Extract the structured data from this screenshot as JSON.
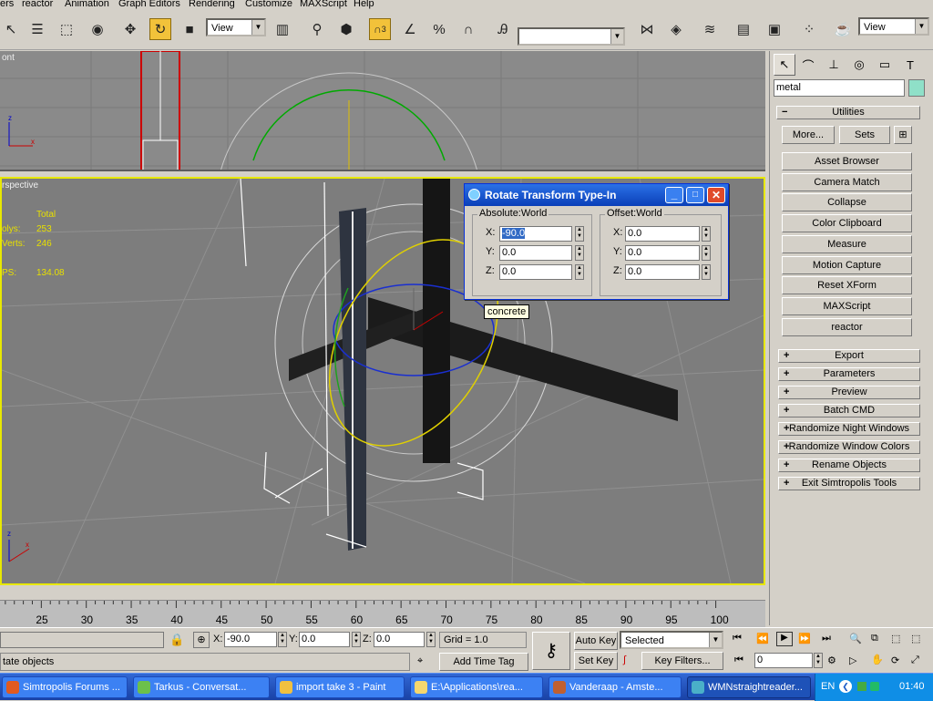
{
  "menu": [
    "ers",
    "reactor",
    "Animation",
    "Graph Editors",
    "Rendering",
    "Customize",
    "MAXScript",
    "Help"
  ],
  "toolbar": {
    "view_dropdown": "View",
    "view_dropdown_right": "View",
    "named_selection": "",
    "snap_num": "3"
  },
  "viewports": {
    "top_label": "ont",
    "persp_label": "rspective",
    "stats_header": "Total",
    "stats_polys_label": "olys:",
    "stats_polys_value": "253",
    "stats_verts_label": "Verts:",
    "stats_verts_value": "246",
    "fps_label": "PS:",
    "fps_value": "134.08",
    "tooltip": "concrete"
  },
  "dialog": {
    "title": "Rotate Transform Type-In",
    "absolute_label": "Absolute:World",
    "offset_label": "Offset:World",
    "abs": {
      "x": "-90.0",
      "y": "0.0",
      "z": "0.0"
    },
    "off": {
      "x": "0.0",
      "y": "0.0",
      "z": "0.0"
    },
    "axis_x": "X:",
    "axis_y": "Y:",
    "axis_z": "Z:"
  },
  "panel": {
    "name_field": "metal",
    "utilities_title": "Utilities",
    "more_button": "More...",
    "sets_button": "Sets",
    "utility_buttons": [
      "Asset Browser",
      "Camera Match",
      "Collapse",
      "Color Clipboard",
      "Measure",
      "Motion Capture",
      "Reset XForm",
      "MAXScript",
      "reactor"
    ],
    "rollouts": [
      "Export",
      "Parameters",
      "Preview",
      "Batch CMD",
      "Randomize Night Windows",
      "Randomize Window Colors",
      "Rename Objects",
      "Exit Simtropolis Tools"
    ]
  },
  "timeline": {
    "ticks": [
      "25",
      "30",
      "35",
      "40",
      "45",
      "50",
      "55",
      "60",
      "65",
      "70",
      "75",
      "80",
      "85",
      "90",
      "95",
      "100"
    ]
  },
  "status": {
    "prompt": "tate objects",
    "x_label": "X:",
    "x_value": "-90.0",
    "y_label": "Y:",
    "y_value": "0.0",
    "z_label": "Z:",
    "z_value": "0.0",
    "grid": "Grid = 1.0",
    "add_time_tag": "Add Time Tag",
    "auto_key": "Auto Key",
    "set_key": "Set Key",
    "key_mode": "Selected",
    "key_filters": "Key Filters...",
    "frame": "0"
  },
  "taskbar": {
    "tasks": [
      "Simtropolis Forums ...",
      "Tarkus - Conversat...",
      "import take 3 - Paint",
      "E:\\Applications\\rea...",
      "Vanderaap - Amste...",
      "WMNstraightreader..."
    ],
    "lang": "EN",
    "clock": "01:40"
  }
}
